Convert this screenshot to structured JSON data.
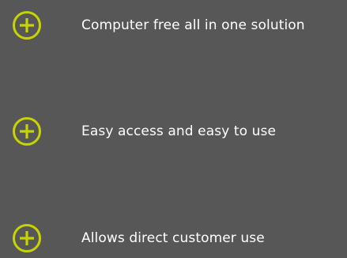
{
  "accent_color": "#c8d400",
  "background_color": "#575757",
  "features": [
    {
      "icon": "plus-circle-icon",
      "label": "Computer free all in one solution"
    },
    {
      "icon": "plus-circle-icon",
      "label": "Easy access and easy to use"
    },
    {
      "icon": "plus-circle-icon",
      "label": "Allows direct customer use"
    }
  ]
}
